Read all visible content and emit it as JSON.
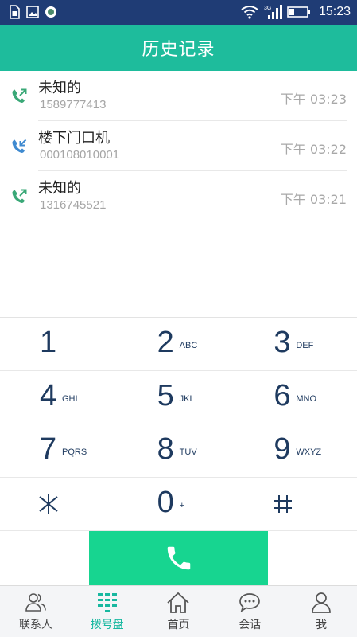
{
  "status_bar": {
    "network_label": "3G",
    "time": "15:23"
  },
  "header": {
    "title": "历史记录"
  },
  "call_log": [
    {
      "name": "未知的",
      "number": "1589777413",
      "time": "下午 03:23",
      "type": "outgoing",
      "icon": "outgoing-call-icon"
    },
    {
      "name": "楼下门口机",
      "number": "000108010001",
      "time": "下午 03:22",
      "type": "incoming",
      "icon": "incoming-call-icon"
    },
    {
      "name": "未知的",
      "number": "1316745521",
      "time": "下午 03:21",
      "type": "outgoing",
      "icon": "outgoing-call-icon"
    }
  ],
  "keypad": {
    "rows": [
      [
        {
          "digit": "1",
          "letters": ""
        },
        {
          "digit": "2",
          "letters": "ABC"
        },
        {
          "digit": "3",
          "letters": "DEF"
        }
      ],
      [
        {
          "digit": "4",
          "letters": "GHI"
        },
        {
          "digit": "5",
          "letters": "JKL"
        },
        {
          "digit": "6",
          "letters": "MNO"
        }
      ],
      [
        {
          "digit": "7",
          "letters": "PQRS"
        },
        {
          "digit": "8",
          "letters": "TUV"
        },
        {
          "digit": "9",
          "letters": "WXYZ"
        }
      ],
      [
        {
          "digit": "*",
          "letters": ""
        },
        {
          "digit": "0",
          "letters": "+"
        },
        {
          "digit": "#",
          "letters": ""
        }
      ]
    ]
  },
  "call_button": {
    "icon": "phone-icon"
  },
  "bottom_nav": {
    "items": [
      {
        "label": "联系人",
        "icon": "contacts-icon",
        "active": false
      },
      {
        "label": "拨号盘",
        "icon": "dialpad-icon",
        "active": true
      },
      {
        "label": "首页",
        "icon": "home-icon",
        "active": false
      },
      {
        "label": "会话",
        "icon": "chat-icon",
        "active": false
      },
      {
        "label": "我",
        "icon": "profile-icon",
        "active": false
      }
    ]
  },
  "colors": {
    "status_bar": "#1f3c75",
    "title_bar": "#1ebc9c",
    "call_button": "#17d590",
    "outgoing_icon": "#3aa877",
    "incoming_icon": "#3f8ad0",
    "nav_active": "#18b8a0",
    "digit": "#1e3a5f"
  }
}
